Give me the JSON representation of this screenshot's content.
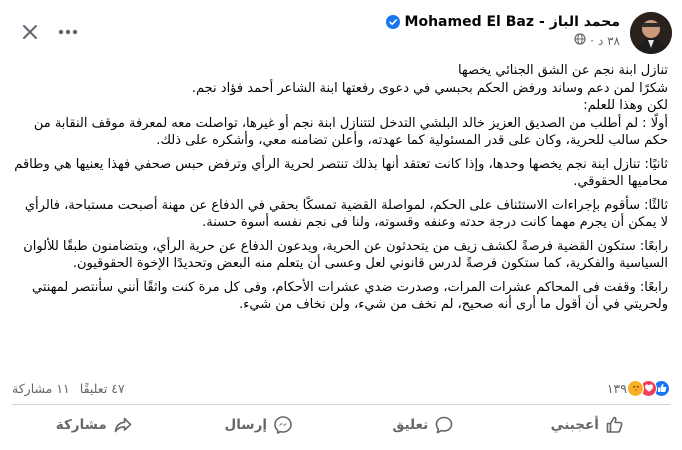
{
  "header": {
    "author_name_ar": "محمد الباز",
    "author_separator": "-",
    "author_name_en": "Mohamed El Baz",
    "timestamp": "٣٨ د",
    "privacy_icon": "globe-icon",
    "more_icon": "more-horizontal-icon",
    "close_icon": "close-icon",
    "verified_color": "#1877f2"
  },
  "post": {
    "paragraphs": [
      "تنازل ابنة نجم عن الشق الجنائي يخصها",
      "شكرًا لمن دعم وساند ورفض الحكم بحبسي في دعوى رفعتها ابنة الشاعر أحمد فؤاد نجم.",
      "لكن وهذا للعلم:",
      "أولًا : لم أطلب من الصديق العزيز خالد البلشي التدخل لتتنازل ابنة نجم أو غيرها، تواصلت معه لمعرفة موقف النقابة من حكم سالب للحرية، وكان على قدر المسئولية كما عهدته، وأعلن تضامنه معي، وأشكره على ذلك.",
      "ثانيًا: تنازل ابنة نجم يخصها وحدها، وإذا كانت تعتقد أنها بذلك تنتصر لحرية الرأي وترفض حبس صحفي فهذا يعنيها هي وطاقم محاميها الحقوقي.",
      "ثالثًا: سأقوم بإجراءات الاستئناف على الحكم، لمواصلة القضية تمسكًا بحقي في الدفاع عن مهنة أصبحت مستباحة، فالرأي لا يمكن أن يجرم مهما كانت درجة حدته وعنفه وقسوته، ولنا فى نجم نفسه أسوة حسنة.",
      "رابعًا: ستكون القضية فرصةً لكشف زيف من يتحدثون عن الحرية، ويدعون الدفاع عن حرية الرأي، ويتضامنون طبقًا للألوان السياسية والفكرية، كما ستكون فرصةً لدرس قانوني لعل وعسى أن يتعلم منه البعض وتحديدًا الإخوة الحقوقيون.",
      "رابعًا: وقفت فى المحاكم عشرات المرات، وصدرت ضدي عشرات الأحكام، وفى كل مرة كنت واثقًا أنني سأنتصر لمهنتي ولحريتي في أن أقول ما أرى أنه صحيح، لم نخف من شيء، ولن نخاف من شيء."
    ]
  },
  "stats": {
    "reactions_count": "١٣٩",
    "reaction_icons": [
      "like-icon",
      "love-icon",
      "care-icon"
    ],
    "like_color": "#1877f2",
    "love_color": "#f33e58",
    "care_color": "#f7b125",
    "comments": "٤٧ تعليقًا",
    "shares": "١١ مشاركة"
  },
  "actions": {
    "like": "أعجبني",
    "comment": "تعليق",
    "send": "إرسال",
    "share": "مشاركة"
  }
}
